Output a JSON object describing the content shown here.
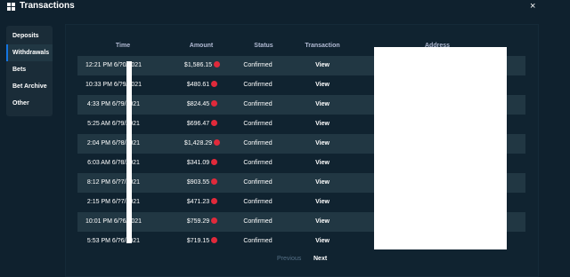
{
  "header": {
    "title": "Transactions",
    "close": "×"
  },
  "sidebar": {
    "items": [
      {
        "label": "Deposits"
      },
      {
        "label": "Withdrawals"
      },
      {
        "label": "Bets"
      },
      {
        "label": "Bet Archive"
      },
      {
        "label": "Other"
      }
    ],
    "active": "Withdrawals"
  },
  "table": {
    "columns": [
      "Time",
      "Amount",
      "Status",
      "Transaction",
      "Address"
    ],
    "rows": [
      {
        "time": "12:21 PM 6/?0/2021",
        "amount": "$1,586.15",
        "status": "Confirmed",
        "action": "View"
      },
      {
        "time": "10:33 PM 6/?9/2021",
        "amount": "$480.61",
        "status": "Confirmed",
        "action": "View"
      },
      {
        "time": "4:33 PM 6/?9/2021",
        "amount": "$824.45",
        "status": "Confirmed",
        "action": "View"
      },
      {
        "time": "5:25 AM 6/?9/2021",
        "amount": "$696.47",
        "status": "Confirmed",
        "action": "View"
      },
      {
        "time": "2:04 PM 6/?8/2021",
        "amount": "$1,428.29",
        "status": "Confirmed",
        "action": "View"
      },
      {
        "time": "6:03 AM 6/?8/2021",
        "amount": "$341.09",
        "status": "Confirmed",
        "action": "View"
      },
      {
        "time": "8:12 PM 6/?7/2021",
        "amount": "$903.55",
        "status": "Confirmed",
        "action": "View"
      },
      {
        "time": "2:15 PM 6/?7/2021",
        "amount": "$471.23",
        "status": "Confirmed",
        "action": "View"
      },
      {
        "time": "10:01 PM 6/?6/2021",
        "amount": "$759.29",
        "status": "Confirmed",
        "action": "View"
      },
      {
        "time": "5:53 PM 6/?6/2021",
        "amount": "$719.15",
        "status": "Confirmed",
        "action": "View"
      }
    ]
  },
  "pagination": {
    "previous": "Previous",
    "next": "Next"
  },
  "icons": {
    "title": "grid-icon",
    "coin": "coin-icon"
  },
  "colors": {
    "accent": "#1475e1",
    "coin": "#e02a3b",
    "bg": "#0f212e",
    "row_alt": "#213743"
  }
}
